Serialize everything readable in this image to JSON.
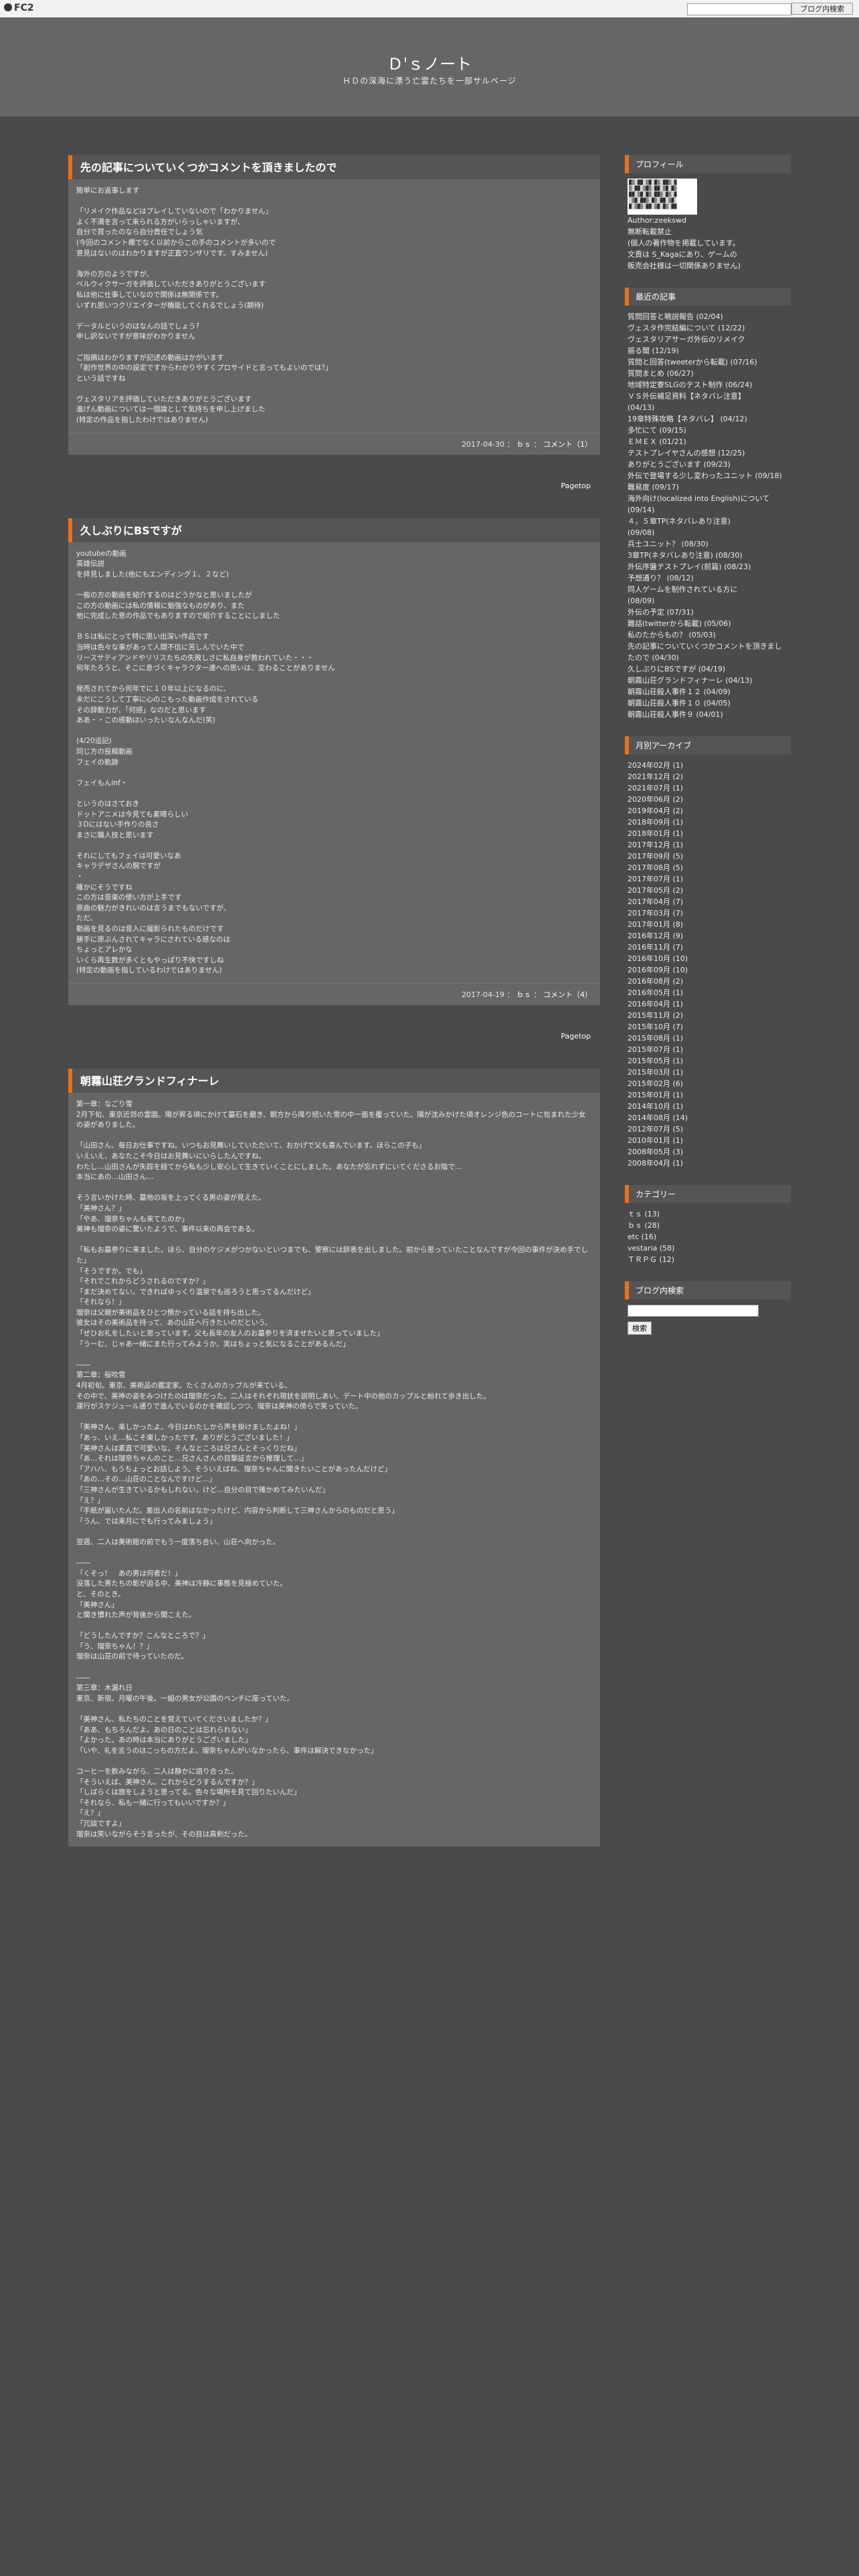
{
  "topbar": {
    "logo": "FC2",
    "search_button": "ブログ内検索"
  },
  "blog": {
    "title": "Ｄ'ｓノート",
    "description": "ＨＤの深海に漂う亡霊たちを一部サルベージ"
  },
  "pagetop": "Pagetop",
  "entries": [
    {
      "title": "先の記事についていくつかコメントを頂きましたので",
      "lines": [
        "簡単にお返事します",
        "",
        "「リメイク作品などはプレイしていないので「わかりません」",
        "よく不満を言って来られる方がいらっしゃいますが、",
        "自分で買ったのなら自分責任でしょう気",
        "(今回のコメント欄でなく以前からこの手のコメントが多いので",
        "意見はないのはわかりますが正直ウンザリです。すみません)",
        "",
        "海外の方のようですが、",
        "ベルウィクサーガを評価していただきありがとうございます",
        "私は他に仕事していなので関係は無関係です。",
        "いずれ思いつクリエイターが機能してくれるでしょう(期待)",
        "",
        "データルというのはなんの話でしょう?",
        "申し訳ないですが意味がわかりません",
        "",
        "ご指摘はわかりますが記述の動画はかがいます",
        "「創作世界の中の設定ですからわかりやすくプロサイドと言ってもよいのでは?」",
        "という話ですね",
        "",
        "ヴェスタリアを評価していただきありがとうございます",
        "進げん動画については一個論として気持ちを申し上げました",
        "(特定の作品を指したわけではありません)"
      ],
      "date": "2017-04-30",
      "category": "ｂｓ",
      "comments": "コメント（1）"
    },
    {
      "title": "久しぶりにBSですが",
      "lines": [
        "youtubeの動画",
        "英雄伝説",
        "を拝見しました(他にもエンディング１、２など)",
        "",
        "一般の方の動画を紹介するのはどうかなと思いましたが",
        "この方の動画には私の情報に勉強なものがあり、また",
        "他に完成した意の作品でもありますので紹介することにしました",
        "",
        "ＢＳは私にとって特に思い出深い作品です",
        "当時は色々な事があって人間不信に苦しんでいた中で",
        "リースサティアンドやリリスたちの失敗しさに私自身が救われていた・・・",
        "何年たろうと、そこに息づくキャラクター達への思いは、変わることがありません",
        "",
        "発売されてから何年でに１０年以上になるのに、",
        "未だにこうして丁寧に心のこもった動画作成をされている",
        "その辞動力が、「何感」なのだと思います",
        "ああ・・この感動はいったいなんなんだ(笑)",
        "",
        "(4/20追記)",
        "同じ方の投稿動画",
        "フェイの軌跡",
        "",
        "フェイもんinf・",
        "",
        "というのはさておき",
        "ドットアニメは今見ても素晴らしい",
        "３Dにはない手作りの良さ",
        "まさに職人技と思います",
        "",
        "それにしてもフェイは可愛いなあ",
        "キャラデザさんの腕ですが",
        "・",
        "確かにそうですね",
        "この方は音楽の使い方が上手です",
        "原曲の魅力がきれいのは言うまでもないですが、",
        "ただ、",
        "動画を見るのは音入に撮影られたものだけです",
        "勝手に原ぶんされてキャラにされている感なのは",
        "ちょっとアレかな",
        "いくら再生数が多くともやっぱり不快ですしね",
        "(特定の動画を指しているわけではありません)"
      ],
      "date": "2017-04-19",
      "category": "ｂｓ",
      "comments": "コメント（4）"
    },
    {
      "title": "朝霧山荘グランドフィナーレ",
      "lines": [
        "第一章：なごり雪",
        "2月下旬、東京近郊の霊園。陽が昇る頃にかけて墓石を磨き、朝方から降り続いた雪の中一面を覆っていた。陽が沈みかけた頃オレンジ色のコートに包まれた少女の姿がありました。",
        "",
        "「山田さん、毎日お仕事ですね。いつもお見舞いしていただいて、おかげで父も喜んでいます。ほらこの子も」",
        "いえいえ、あなたこそ今日はお見舞いにいらしたんですね。",
        "わたし…山田さんが失踪を経てから私も少し安心して生きていくことにしました。あなたが忘れずにいてくださるお陰で…",
        "本当にあの…山田さん…",
        "",
        "そう言いかけた時、墓地の坂を上ってくる男の姿が見えた。",
        "「美神さん？」",
        "「やあ、瑠奈ちゃんも来てたのか」",
        "美神も瑠奈の姿に驚いたようで、事件以来の再会である。",
        "",
        "「私もお墓参りに来ました。ほら、自分のケジメがつかないといつまでも、警察には辞表を出しました。前から思っていたことなんですが今回の事件が決め手でした」",
        "「そうですか。でも」",
        "「それでこれからどうされるのですか？」",
        "「まだ決めてない。できればゆっくり温泉でも巡ろうと思ってるんだけど」",
        "「それなら！」",
        "瑠奈は父親が美術品をひとつ預かっている話を持ち出した。",
        "彼女はその美術品を持って、あの山荘へ行きたいのだという。",
        "「ぜひお礼をしたいと思っています。父も長年の友人のお墓参りを済ませたいと思っていました」",
        "「うーむ、じゃあ一緒にまた行ってみようか。実はちょっと気になることがあるんだ」",
        "",
        "――",
        "第二章：桜吹雪",
        "4月初旬。東京、美術品の鑑定家。たくさんのカップルが来ている。",
        "その中で、美神の姿をみつけたのは瑠奈だった。二人はそれぞれ現状を説明しあい、デート中の他のカップルと紛れて歩き出した。",
        "運行がスケジュール通りで進んでいるのかを確認しつつ、瑠奈は美神の傍らで笑っていた。",
        "",
        "「美神さん、楽しかったよ。今日はわたしから声を掛けましたよね！」",
        "「あっ、いえ…私こそ楽しかったです。ありがとうございました！」",
        "「美神さんは素直で可愛いな。そんなところは兄さんとそっくりだね」",
        "「あ…それは瑠奈ちゃんのこと…兄さんさんの目撃証言から推理して…」",
        "「アハハ、もうちょっとお話しよう。そういえばね、瑠奈ちゃんに聞きたいことがあったんだけど」",
        "「あの…その…山荘のことなんですけど…」",
        "「三神さんが生きているかもしれない。けど…自分の目で確かめてみたいんだ」",
        "「え？」",
        "「手紙が届いたんだ。差出人の名前はなかったけど、内容から判断して三神さんからのものだと思う」",
        "「うん、では来月にでも行ってみましょう」",
        "",
        "翌週、二人は美術館の前でもう一度落ち合い、山荘へ向かった。",
        "",
        "――",
        "「くそっ！　あの男は何者だ！」",
        "没落した男たちの影が迫る中、美神は冷静に事態を見極めていた。",
        "と、そのとき。",
        "「美神さん」",
        "と聞き慣れた声が背後から聞こえた。",
        "",
        "「どうしたんですか？こんなところで？」",
        "「う、瑠奈ちゃん！？」",
        "瑠奈は山荘の前で待っていたのだ。",
        "",
        "――",
        "第三章：木漏れ日",
        "東京、新宿。月曜の午後。一組の男女が公園のベンチに座っていた。",
        "",
        "「美神さん、私たちのことを覚えていてくださいましたか？」",
        "「ああ、もちろんだよ。あの日のことは忘れられない」",
        "「よかった。あの時は本当にありがとうございました」",
        "「いや、礼を言うのはこっちの方だよ。瑠奈ちゃんがいなかったら、事件は解決できなかった」",
        "",
        "コーヒーを飲みながら、二人は静かに語り合った。",
        "「そういえば、美神さん。これからどうするんですか？」",
        "「しばらくは旅をしようと思ってる。色々な場所を見て回りたいんだ」",
        "「それなら、私も一緒に行ってもいいですか？」",
        "「え？」",
        "「冗談ですよ」",
        "瑠奈は笑いながらそう言ったが、その目は真剣だった。"
      ],
      "date": "",
      "category": "",
      "comments": ""
    }
  ],
  "sidebar": {
    "profile": {
      "heading": "プロフィール",
      "author_label": "Author:zeekswd",
      "lines": [
        "無断転載禁止",
        "(個人の著作物を掲載しています。",
        "文責は S_Kagaにあり、ゲームの",
        "販売会社様は一切関係ありません)"
      ]
    },
    "recent": {
      "heading": "最近の記事",
      "items": [
        "質問回答と暁説報告 (02/04)",
        "ヴェスタ作完結編について (12/22)",
        "ヴェスタリアサーガ外伝のリメイク",
        "振る聞 (12/19)",
        "質問と回答(tweeterから転載) (07/16)",
        "質問まとめ (06/27)",
        "地域特定寮SLGのテスト制作 (06/24)",
        "ＶＳ外伝補足資料【ネタバレ注意】",
        "(04/13)",
        "19章特殊攻略【ネタバレ】 (04/12)",
        "多忙にて (09/15)",
        "ＥＭＥＸ (01/21)",
        "テストプレイヤさんの感想 (12/25)",
        "ありがとうございます (09/23)",
        "外伝で登場する少し変わったユニット (09/18)",
        "難易度 (09/17)",
        "海外向け(localized into English)について (09/14)",
        "４，５章TP(ネタバレあり注意)",
        "(09/08)",
        "兵士ユニット？ (08/30)",
        "3章TP(ネタバレあり注意) (08/30)",
        "外伝序盤テストプレイ(前篇) (08/23)",
        "予想通り？ (08/12)",
        "同人ゲームを制作されている方に",
        "(08/09)",
        "外伝の予定 (07/31)",
        "難詰(twitterから転載) (05/06)",
        "私のたからもの？ (05/03)",
        "先の記事についていくつかコメントを頂きましたので (04/30)",
        "久しぶりにBSですが (04/19)",
        "朝霧山荘グランドフィナーレ (04/13)",
        "朝霧山荘殺人事件１２ (04/09)",
        "朝霧山荘殺人事件１０ (04/05)",
        "朝霧山荘殺人事件９ (04/01)"
      ]
    },
    "archives": {
      "heading": "月別アーカイブ",
      "items": [
        "2024年02月 (1)",
        "2021年12月 (2)",
        "2021年07月 (1)",
        "2020年06月 (2)",
        "2019年04月 (2)",
        "2018年09月 (1)",
        "2018年01月 (1)",
        "2017年12月 (1)",
        "2017年09月 (5)",
        "2017年08月 (5)",
        "2017年07月 (1)",
        "2017年05月 (2)",
        "2017年04月 (7)",
        "2017年03月 (7)",
        "2017年01月 (8)",
        "2016年12月 (9)",
        "2016年11月 (7)",
        "2016年10月 (10)",
        "2016年09月 (10)",
        "2016年08月 (2)",
        "2016年05月 (1)",
        "2016年04月 (1)",
        "2015年11月 (2)",
        "2015年10月 (7)",
        "2015年08月 (1)",
        "2015年07月 (1)",
        "2015年05月 (1)",
        "2015年03月 (1)",
        "2015年02月 (6)",
        "2015年01月 (1)",
        "2014年10月 (1)",
        "2014年08月 (14)",
        "2012年07月 (5)",
        "2010年01月 (1)",
        "2008年05月 (3)",
        "2008年04月 (1)"
      ]
    },
    "categories": {
      "heading": "カテゴリー",
      "items": [
        "ｔｓ (13)",
        "ｂｓ (28)",
        "etc (16)",
        "vestaria (58)",
        "ＴＲＰＧ (12)"
      ]
    },
    "search": {
      "heading": "ブログ内検索",
      "button": "検索"
    }
  }
}
